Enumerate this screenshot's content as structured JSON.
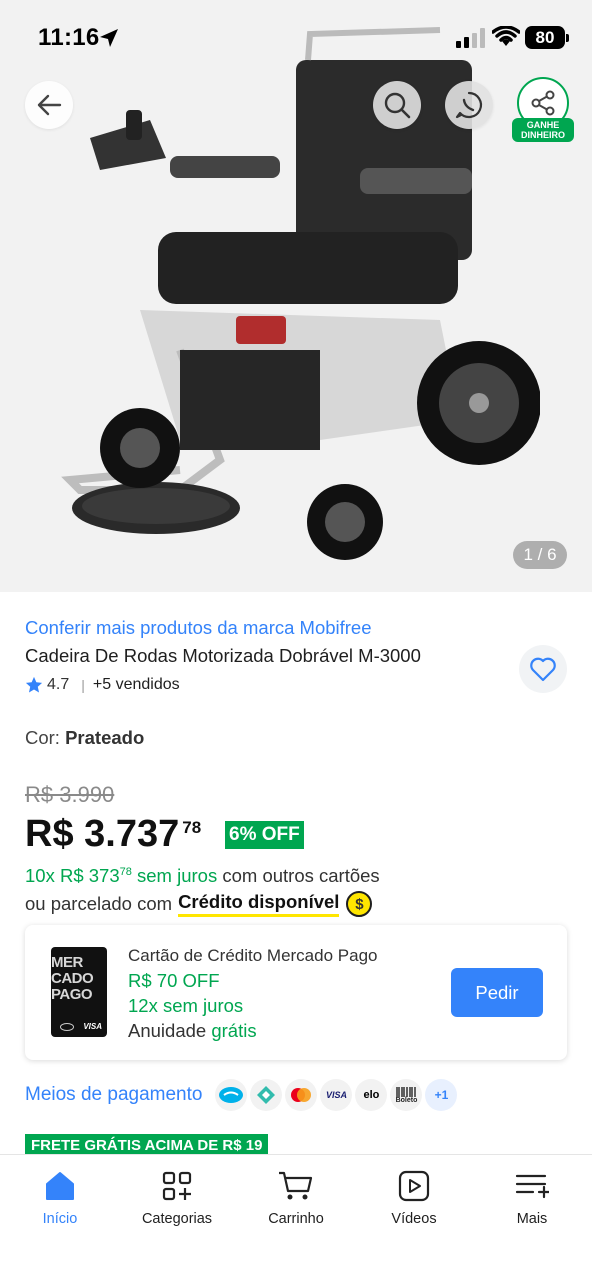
{
  "status": {
    "time": "11:16",
    "battery": "80"
  },
  "hero": {
    "counter": "1 / 6",
    "share_badge": "GANHE DINHEIRO"
  },
  "product": {
    "brand_link": "Conferir mais produtos da marca Mobifree",
    "title": "Cadeira De Rodas Motorizada Dobrável M-3000",
    "rating": "4.7",
    "sold": "+5 vendidos",
    "color_label": "Cor:",
    "color_value": "Prateado",
    "old_price": "R$ 3.990",
    "price_main": "R$ 3.737",
    "price_cents": "78",
    "discount": "6% OFF"
  },
  "installments": {
    "green_prefix": "10x R$ 373",
    "green_cents": "78",
    "green_suffix": "sem juros",
    "rest": "com outros cartões",
    "line2_prefix": "ou parcelado com",
    "credit": "Crédito disponível",
    "coin_symbol": "$"
  },
  "card_offer": {
    "card_text": "MER CADO PAGO",
    "card_brand": "VISA",
    "title": "Cartão de Crédito Mercado Pago",
    "off": "R$ 70 OFF",
    "installments": "12x sem juros",
    "annuity_label": "Anuidade",
    "annuity_value": "grátis",
    "button": "Pedir"
  },
  "payment": {
    "label": "Meios de pagamento",
    "icons": [
      "mercadopago-icon",
      "pix-icon",
      "mastercard-icon",
      "visa-icon",
      "elo-icon",
      "boleto-icon"
    ],
    "visa_text": "VISA",
    "elo_text": "elo",
    "boleto_text": "Boleto",
    "more": "+1"
  },
  "frete": "FRETE GRÁTIS ACIMA DE R$ 19",
  "nav": {
    "items": [
      {
        "label": "Início",
        "icon": "home-icon"
      },
      {
        "label": "Categorias",
        "icon": "categories-icon"
      },
      {
        "label": "Carrinho",
        "icon": "cart-icon"
      },
      {
        "label": "Vídeos",
        "icon": "video-icon"
      },
      {
        "label": "Mais",
        "icon": "menu-icon"
      }
    ]
  },
  "colors": {
    "accent": "#3483fa",
    "green": "#00a650",
    "yellow": "#ffe600"
  }
}
